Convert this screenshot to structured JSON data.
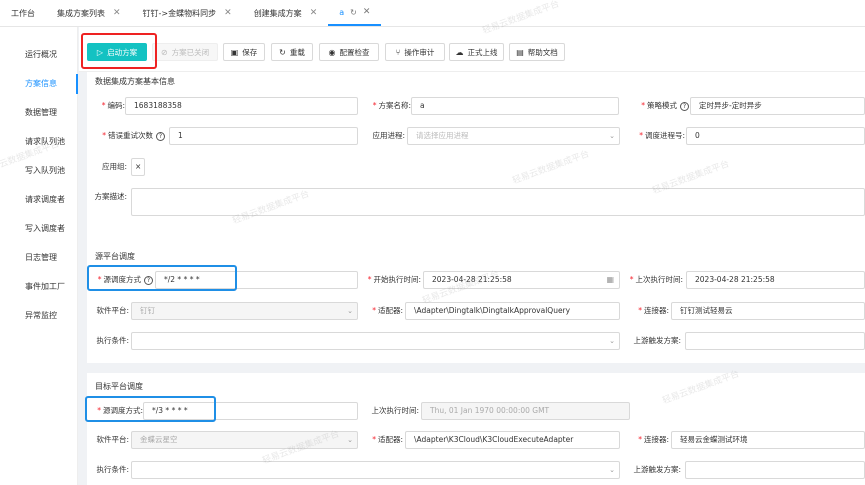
{
  "tabs": [
    {
      "label": "工作台",
      "closable": false
    },
    {
      "label": "集成方案列表",
      "closable": true
    },
    {
      "label": "钉钉->金蝶物料同步",
      "closable": true
    },
    {
      "label": "创建集成方案",
      "closable": true
    },
    {
      "label": "a",
      "closable": true,
      "active": true
    }
  ],
  "sidebar": {
    "items": [
      "运行概况",
      "方案信息",
      "数据管理",
      "请求队列池",
      "写入队列池",
      "请求调度者",
      "写入调度者",
      "日志管理",
      "事件加工厂",
      "异常监控"
    ],
    "active_index": 1
  },
  "toolbar": {
    "start": "启动方案",
    "closed": "方案已关闭",
    "save": "保存",
    "reload": "重载",
    "config_check": "配置检查",
    "audit": "操作审计",
    "go_live": "正式上线",
    "help_doc": "帮助文档"
  },
  "basic": {
    "title": "数据集成方案基本信息",
    "code_label": "编码:",
    "code_value": "1683188358",
    "name_label": "方案名称:",
    "name_value": "a",
    "strategy_label": "策略模式",
    "strategy_value": "定时异步-定时异步",
    "retry_label": "错误重试次数",
    "retry_value": "1",
    "app_process_label": "应用进程:",
    "app_process_placeholder": "请选择应用进程",
    "sched_process_label": "调度进程号:",
    "sched_process_value": "0",
    "app_group_label": "应用组:",
    "desc_label": "方案描述:"
  },
  "source": {
    "title": "源平台调度",
    "mode_label": "源调度方式",
    "mode_value": "*/2 * * * *",
    "start_time_label": "开始执行时间:",
    "start_time_value": "2023-04-28 21:25:58",
    "last_time_label": "上次执行时间:",
    "last_time_value": "2023-04-28 21:25:58",
    "platform_label": "软件平台:",
    "platform_value": "钉钉",
    "adapter_label": "适配器:",
    "adapter_value": "\\Adapter\\Dingtalk\\DingtalkApprovalQuery",
    "connector_label": "连接器:",
    "connector_value": "钉钉测试轻易云",
    "condition_label": "执行条件:",
    "upstream_label": "上游触发方案:"
  },
  "target": {
    "title": "目标平台调度",
    "mode_label": "源调度方式:",
    "mode_value": "*/3 * * * *",
    "last_time_label": "上次执行时间:",
    "last_time_value": "Thu, 01 Jan 1970 00:00:00 GMT",
    "platform_label": "软件平台:",
    "platform_value": "金蝶云星空",
    "adapter_label": "适配器:",
    "adapter_value": "\\Adapter\\K3Cloud\\K3CloudExecuteAdapter",
    "connector_label": "连接器:",
    "connector_value": "轻易云金蝶测试环境",
    "condition_label": "执行条件:",
    "upstream_label": "上游触发方案:"
  },
  "watermark": "轻易云数据集成平台",
  "colors": {
    "primary": "#13c2c2",
    "link": "#1890ff",
    "highlight_red": "#e22222",
    "highlight_blue": "#1f8fe6",
    "required": "#f5222d"
  }
}
